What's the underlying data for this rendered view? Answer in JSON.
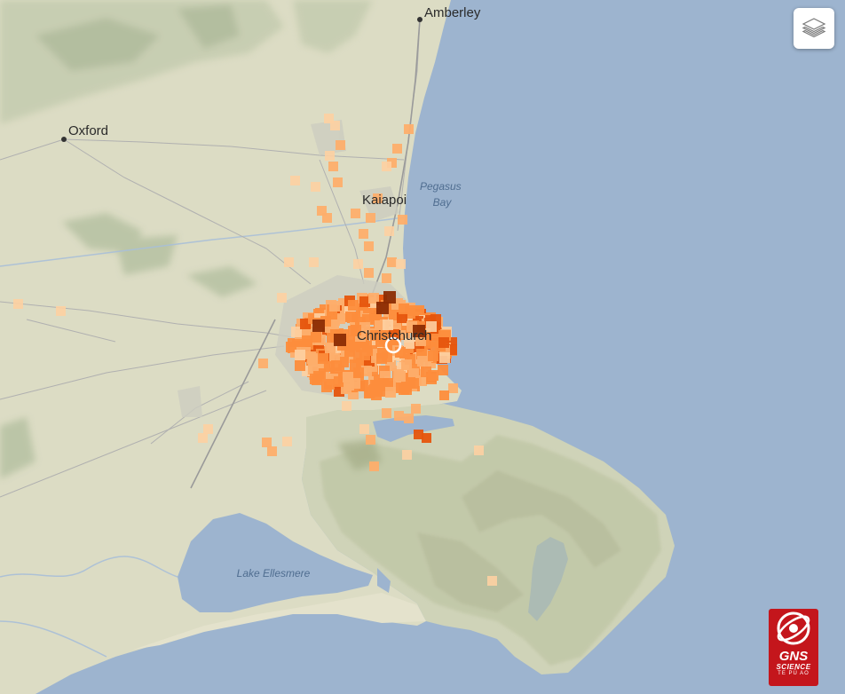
{
  "map": {
    "place_labels": [
      {
        "key": "amberley",
        "text": "Amberley"
      },
      {
        "key": "oxford",
        "text": "Oxford"
      },
      {
        "key": "kaiapoi",
        "text": "Kaiapoi"
      },
      {
        "key": "christchurch",
        "text": "Christchurch"
      }
    ],
    "water_labels": [
      {
        "key": "pegasus-bay",
        "lines": [
          "Pegasus",
          "Bay"
        ]
      },
      {
        "key": "lake-ellesmere",
        "lines": [
          "Lake Ellesmere"
        ]
      }
    ]
  },
  "controls": {
    "layers_icon": "layers-icon"
  },
  "branding": {
    "logo_name": "GNS",
    "logo_sub1": "SCIENCE",
    "logo_sub2": "TE PŪ AO"
  },
  "colors": {
    "water": "#9db4cf",
    "land": "#dcdcc4",
    "hills": "#c7ceb0",
    "intensity_very_light": "#fdd0a2",
    "intensity_light": "#fdae6b",
    "intensity_moderate": "#fd8d3c",
    "intensity_strong": "#e6550d",
    "intensity_very_strong": "#8c2d04"
  }
}
